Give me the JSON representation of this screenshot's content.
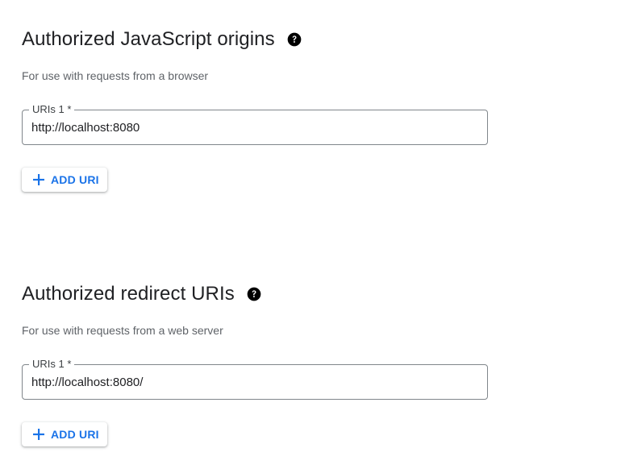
{
  "javascript_origins": {
    "title": "Authorized JavaScript origins",
    "help_icon": "help-circle-icon",
    "description": "For use with requests from a browser",
    "uri_field": {
      "label": "URIs 1 *",
      "value": "http://localhost:8080"
    },
    "add_button": {
      "icon": "plus-icon",
      "label": "ADD URI"
    }
  },
  "redirect_uris": {
    "title": "Authorized redirect URIs",
    "help_icon": "help-circle-icon",
    "description": "For use with requests from a web server",
    "uri_field": {
      "label": "URIs 1 *",
      "value": "http://localhost:8080/"
    },
    "add_button": {
      "icon": "plus-icon",
      "label": "ADD URI"
    }
  },
  "colors": {
    "accent": "#1a73e8",
    "text_primary": "#202124",
    "text_secondary": "#5f6368",
    "field_border": "#80868b"
  }
}
